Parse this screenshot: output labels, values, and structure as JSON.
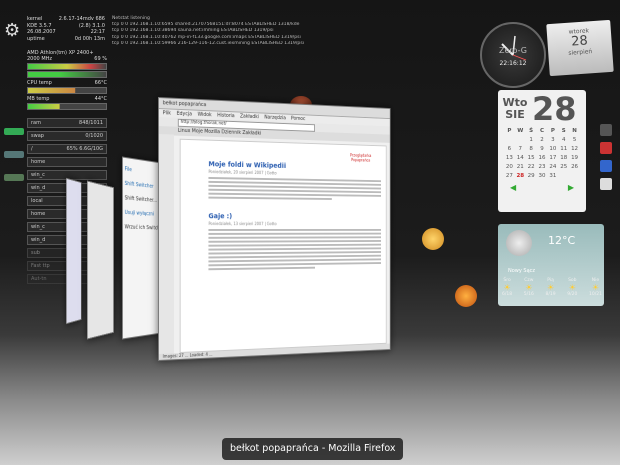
{
  "system_monitor": {
    "kernel_label": "kernel",
    "kernel_value": "2.6.17-14mdv 686",
    "kde_label": "KDE 3.5.7",
    "kde_value": "(2.8) 3.1.0",
    "date": "26.08.2007",
    "time": "22:17",
    "uptime_label": "uptime",
    "uptime_value": "0d 00h 13m",
    "cpu_name": "AMD Athlon(tm) XP 2400+",
    "cpu_freq": "2000 MHz",
    "cpu_pct": "69 %",
    "cpu_temp_label": "CPU temp",
    "cpu_temp": "66°C",
    "mb_temp_label": "MB temp",
    "mb_temp": "44°C",
    "ram_label": "ram",
    "ram_value": "848/1011",
    "swap_label": "swap",
    "swap_value": "0/1020",
    "root_label": "/",
    "root_value": "65% 6.6G/10G",
    "items": [
      "home",
      "win_c",
      "win_d",
      "local",
      "home",
      "win_c",
      "win_d"
    ],
    "panel_items": [
      "sub",
      "Fast ttp",
      "Aut-tn"
    ]
  },
  "netstat": {
    "header": "Netstat listening",
    "rows": [
      "tcp  0  0 192.168.1.10:6595   shared.21707568151:dr:8074 ESTABLISHED 1318/kde",
      "tcp  0  0 192.168.1.10:38694  sauna.net:imming           ESTABLISHED 1319/psi",
      "tcp  0  0 192.168.1.10:40762  mp-in-f133.google.com:imaps ESTABLISHED 1319/psi",
      "tcp  0  0 192.168.1.10:59966  216-129-116-12.cust.iexmining ESTABLISHED 1319/psi"
    ]
  },
  "clock": {
    "brand": "Zero-G",
    "time": "22:16:12"
  },
  "note": {
    "weekday": "wtorek",
    "day": "28",
    "month": "sierpień"
  },
  "calendar": {
    "weekday_short": "Wto",
    "month_short": "SIE",
    "day": "28",
    "header_days": [
      "P",
      "W",
      "Ś",
      "C",
      "P",
      "S",
      "N"
    ],
    "days": [
      "",
      "",
      "1",
      "2",
      "3",
      "4",
      "5",
      "6",
      "7",
      "8",
      "9",
      "10",
      "11",
      "12",
      "13",
      "14",
      "15",
      "16",
      "17",
      "18",
      "19",
      "20",
      "21",
      "22",
      "23",
      "24",
      "25",
      "26",
      "27",
      "28",
      "29",
      "30",
      "31",
      "",
      ""
    ]
  },
  "weather": {
    "temp": "12°C",
    "location": "Nowy Sącz",
    "days": [
      "Śro",
      "Czw",
      "Pią",
      "Sob",
      "Nie"
    ],
    "ranges": [
      "6/18",
      "5/16",
      "8/19",
      "9/20",
      "10/21"
    ]
  },
  "window_switcher": {
    "caption": "bełkot popaprańca - Mozilla Firefox"
  },
  "firefox": {
    "title": "bełkot popaprańca",
    "menu": [
      "Plik",
      "Edycja",
      "Widok",
      "Historia",
      "Zakładki",
      "Narzędzia",
      "Pomoc"
    ],
    "url": "http://blog.thorak.net/",
    "tabs": "Linux  Moje  Mozilla  Dziennik  Zakładki",
    "post1_title": "Moje foldi w Wikipedii",
    "post1_meta": "Poniedziałek, 20 sierpień 2007  |  Gotto",
    "post2_title": "Gaje :)",
    "post2_meta": "Poniedziałek, 13 sierpień 2007  |  Gotto",
    "logo_text": "Przeglądarka Popaprańca",
    "status": "Images: 27 ... Loaded: 4 ..."
  },
  "side_window": {
    "items": [
      "File",
      "Shift Switcher",
      "Shift Switcher...",
      "Usuji wyłączni",
      "Wrzuć ich Switcher"
    ]
  }
}
